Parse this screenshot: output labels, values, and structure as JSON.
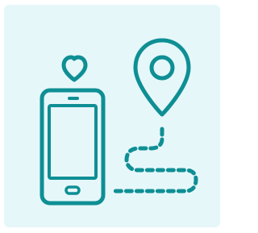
{
  "tile": {
    "background_color": "#e6f7fa"
  },
  "illustration": {
    "description_icons": [
      "heart-icon",
      "smartphone-icon",
      "map-pin-icon",
      "dashed-route-icon"
    ],
    "stroke_color": "#0e8f94"
  }
}
